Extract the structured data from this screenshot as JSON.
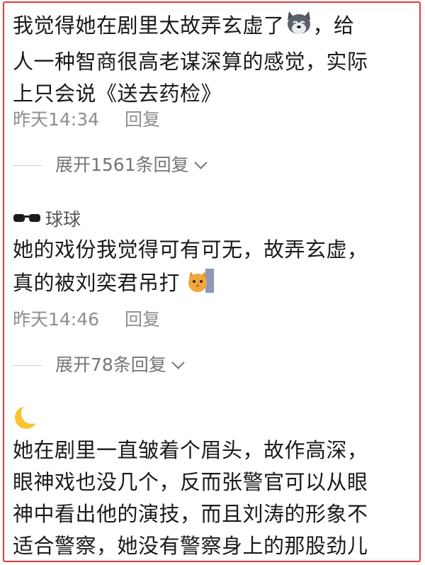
{
  "comments": [
    {
      "text_line1": "我觉得她在剧里太故弄玄虚了",
      "text_line1_tail": "，给",
      "text_line2": "人一种智商很高老谋深算的感觉，实际",
      "text_line3": "上只会说《送去药检》",
      "time": "昨天14:34",
      "reply_label": "回复",
      "expand_label": "展开1561条回复",
      "emoji_icon": "dog-emoji-icon"
    },
    {
      "username": "球球",
      "avatar_icon": "sunglasses-icon",
      "text_line1": "她的戏份我觉得可有可无，故弄玄虚，",
      "text_line2": "真的被刘奕君吊打",
      "time": "昨天14:46",
      "reply_label": "回复",
      "expand_label": "展开78条回复",
      "emoji_icon": "cat-emoji-icon"
    },
    {
      "avatar_icon": "crescent-moon-icon",
      "text_line1": "她在剧里一直皱着个眉头，故作高深，",
      "text_line2": "眼神戏也没几个，反而张警官可以从眼",
      "text_line3": "神中看出他的演技，而且刘涛的形象不",
      "text_line4": "适合警察，她没有警察身上的那股劲儿"
    }
  ],
  "colors": {
    "frame_border": "#e5393c",
    "meta_text": "#8e8e8e"
  }
}
